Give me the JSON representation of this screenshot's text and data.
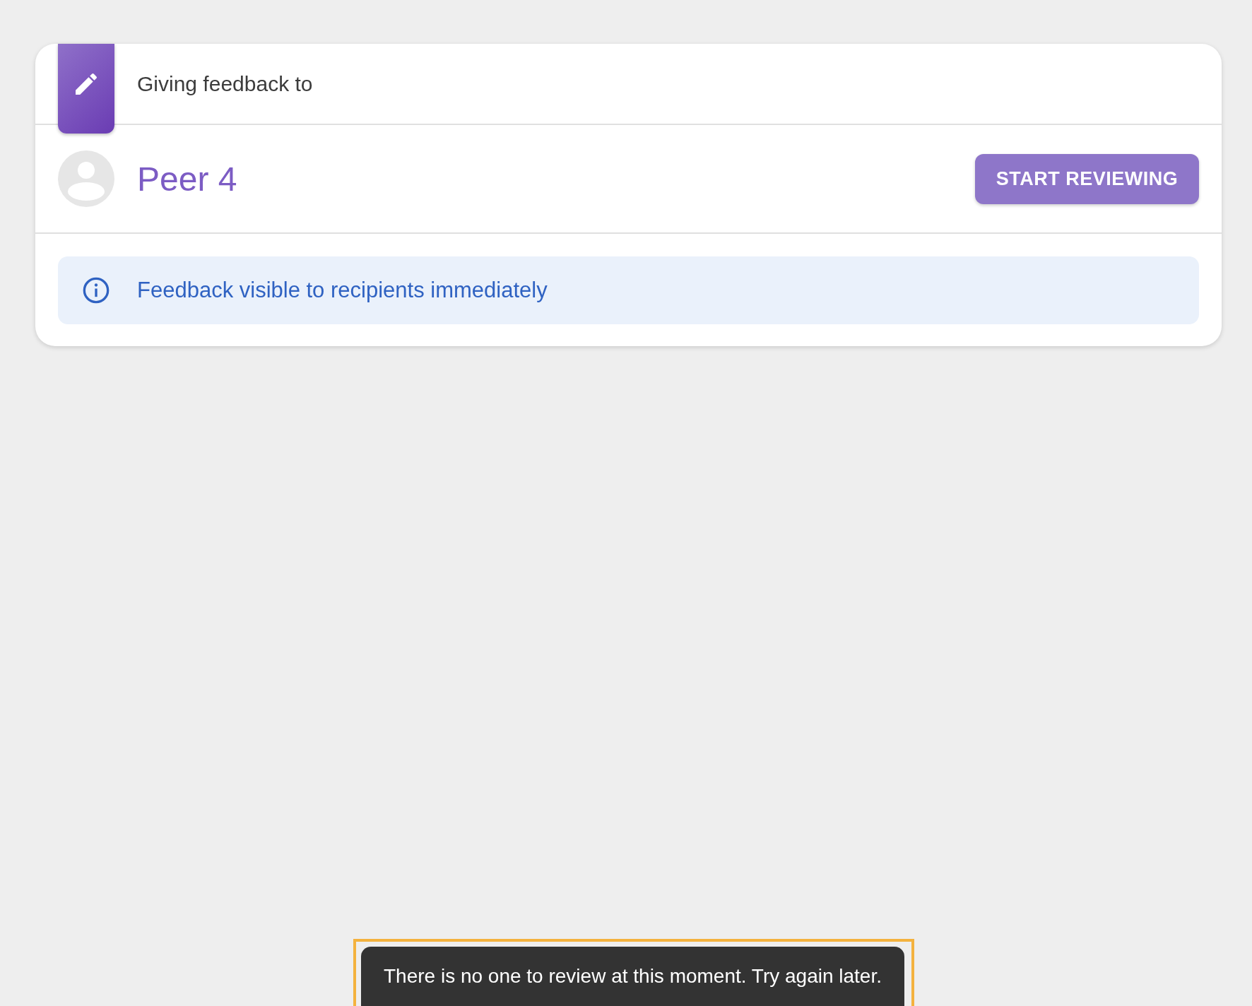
{
  "header": {
    "title": "Giving feedback to"
  },
  "recipient": {
    "name": "Peer 4",
    "action": "START REVIEWING"
  },
  "notice": {
    "text": "Feedback visible to recipients immediately"
  },
  "toast": {
    "message": "There is no one to review at this moment. Try again later.",
    "highlighted": true
  }
}
